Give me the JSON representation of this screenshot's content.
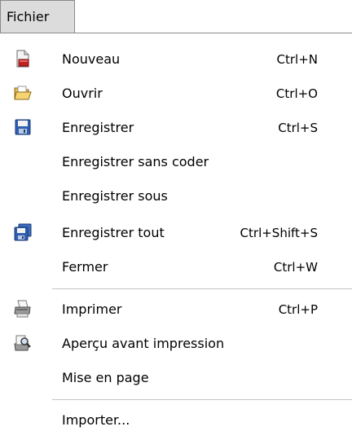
{
  "menubar": {
    "active_menu": "Fichier"
  },
  "menu": {
    "items": [
      {
        "label": "Nouveau",
        "shortcut": "Ctrl+N",
        "icon": "new-document-icon"
      },
      {
        "label": "Ouvrir",
        "shortcut": "Ctrl+O",
        "icon": "open-folder-icon"
      },
      {
        "label": "Enregistrer",
        "shortcut": "Ctrl+S",
        "icon": "save-disk-icon"
      },
      {
        "label": "Enregistrer sans coder",
        "shortcut": "",
        "icon": ""
      },
      {
        "label": "Enregistrer sous",
        "shortcut": "",
        "icon": ""
      },
      {
        "label": "Enregistrer tout",
        "shortcut": "Ctrl+Shift+S",
        "icon": "save-all-icon"
      },
      {
        "label": "Fermer",
        "shortcut": "Ctrl+W",
        "icon": ""
      },
      {
        "label": "Imprimer",
        "shortcut": "Ctrl+P",
        "icon": "printer-icon"
      },
      {
        "label": "Aperçu avant impression",
        "shortcut": "",
        "icon": "print-preview-icon"
      },
      {
        "label": "Mise en page",
        "shortcut": "",
        "icon": ""
      },
      {
        "label": "Importer...",
        "shortcut": "",
        "icon": ""
      }
    ]
  },
  "colors": {
    "menubar_active_bg": "#dcdcdc",
    "separator": "#c5c5c5"
  }
}
